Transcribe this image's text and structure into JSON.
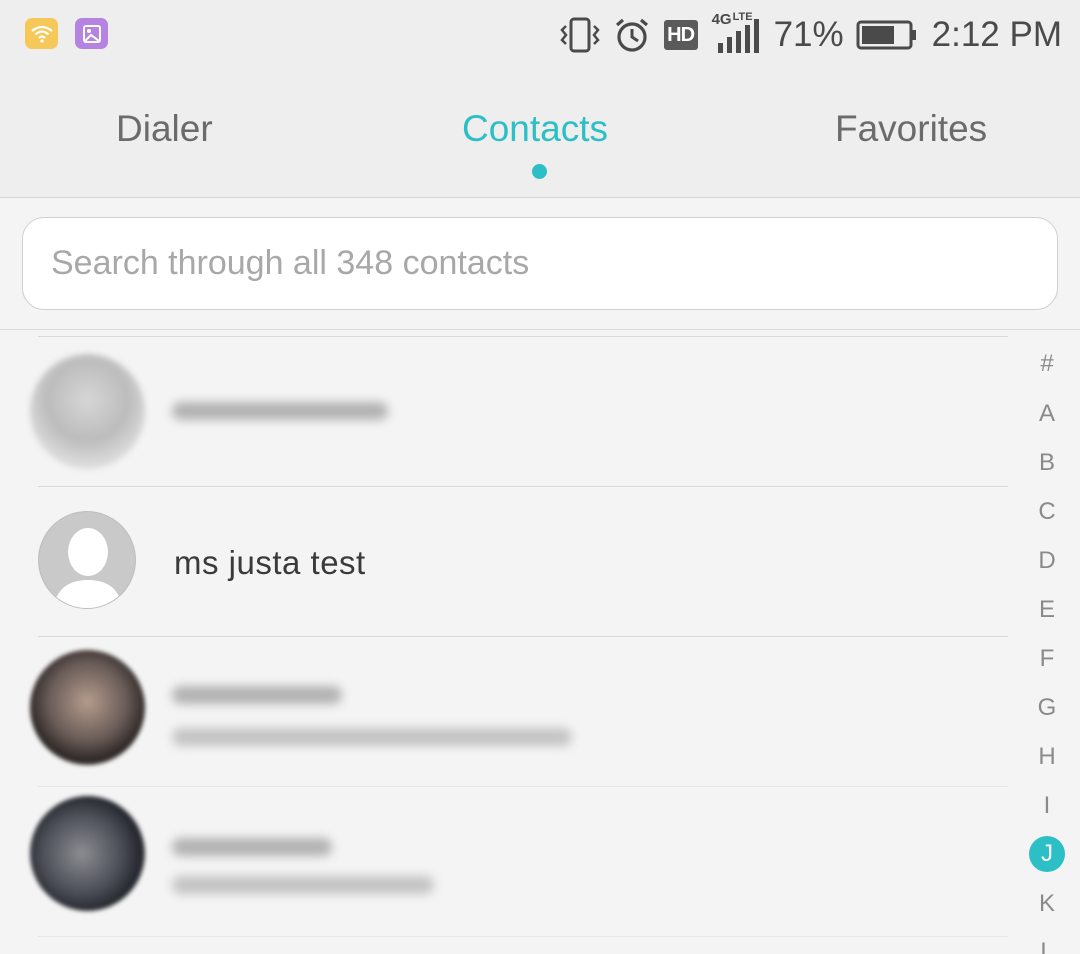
{
  "status_bar": {
    "notifications": [
      {
        "icon": "wifi-notification-icon",
        "color": "#f6c85a"
      },
      {
        "icon": "gallery-notification-icon",
        "color": "#b583e2"
      }
    ],
    "icons": [
      "vibrate-icon",
      "alarm-icon",
      "hd-voice-icon",
      "signal-4g-lte-icon",
      "battery-icon"
    ],
    "hd_label": "HD",
    "network_label": "4G",
    "network_sub_label": "LTE",
    "battery_percent": "71%",
    "battery_level": 0.71,
    "time": "2:12 PM"
  },
  "tabs": [
    {
      "label": "Dialer",
      "active": false
    },
    {
      "label": "Contacts",
      "active": true
    },
    {
      "label": "Favorites",
      "active": false
    }
  ],
  "search": {
    "placeholder": "Search through all 348 contacts",
    "value": ""
  },
  "contacts": [
    {
      "name": "",
      "redacted": true,
      "avatar": "photo"
    },
    {
      "name": "ms justa test",
      "redacted": false,
      "avatar": "default"
    },
    {
      "name": "",
      "redacted": true,
      "avatar": "photo"
    },
    {
      "name": "",
      "redacted": true,
      "avatar": "photo"
    }
  ],
  "alphabet_index": {
    "letters": [
      "#",
      "A",
      "B",
      "C",
      "D",
      "E",
      "F",
      "G",
      "H",
      "I",
      "J",
      "K",
      "L"
    ],
    "active": "J"
  },
  "colors": {
    "accent": "#2cbfc5",
    "background": "#f4f4f4",
    "text_primary": "#3a3a3a",
    "text_secondary": "#6b6b6b"
  }
}
